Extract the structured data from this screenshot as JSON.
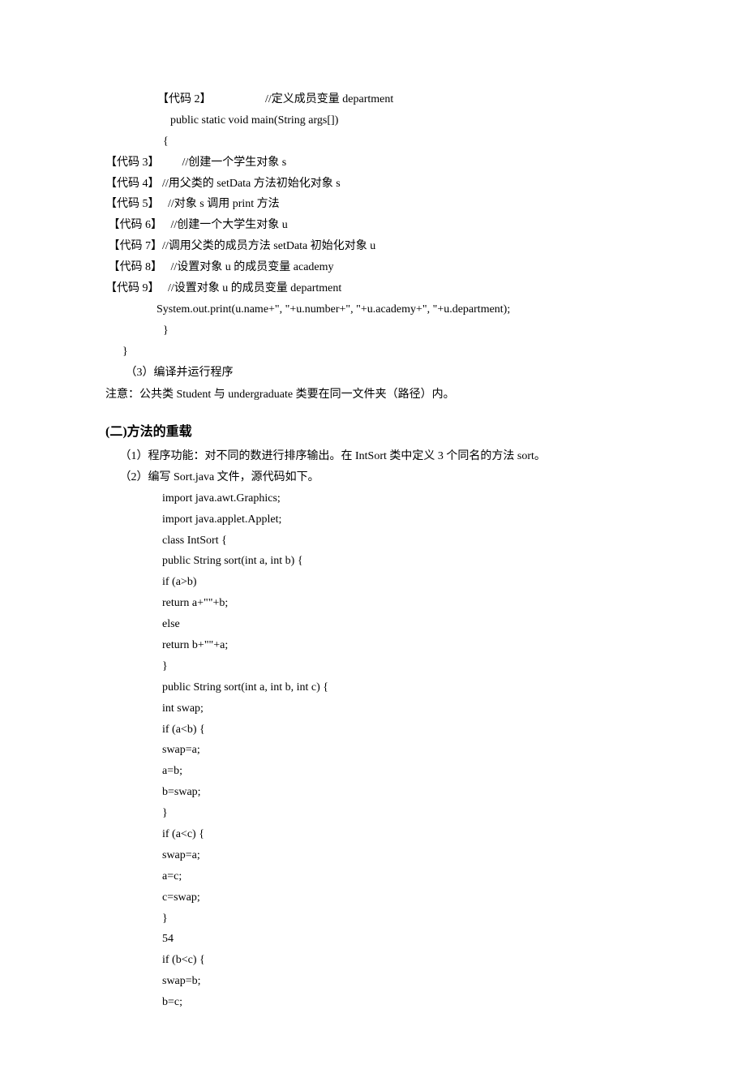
{
  "lines": [
    {
      "cls": "line indent1",
      "text": "【代码 2】                   //定义成员变量 department"
    },
    {
      "cls": "line indent2",
      "text": "public static void main(String args[])"
    },
    {
      "cls": "line indent1",
      "text": "  {"
    },
    {
      "cls": "line",
      "text": "【代码 3】        //创建一个学生对象 s"
    },
    {
      "cls": "line",
      "text": "【代码 4】 //用父类的 setData 方法初始化对象 s"
    },
    {
      "cls": "line",
      "text": "【代码 5】   //对象 s 调用 print 方法"
    },
    {
      "cls": "line",
      "text": " 【代码 6】   //创建一个大学生对象 u"
    },
    {
      "cls": "line",
      "text": " 【代码 7】//调用父类的成员方法 setData 初始化对象 u"
    },
    {
      "cls": "line",
      "text": " 【代码 8】   //设置对象 u 的成员变量 academy"
    },
    {
      "cls": "line",
      "text": "【代码 9】   //设置对象 u 的成员变量 department"
    },
    {
      "cls": "line",
      "text": "                  System.out.print(u.name+\", \"+u.number+\", \"+u.academy+\", \"+u.department);"
    },
    {
      "cls": "line indent1",
      "text": "  }"
    },
    {
      "cls": "line",
      "text": "      }"
    },
    {
      "cls": "line",
      "text": "       （3）编译并运行程序"
    },
    {
      "cls": "line note",
      "text": "注意：公共类 Student 与 undergraduate 类要在同一文件夹（路径）内。"
    },
    {
      "cls": "heading",
      "text": "(二)方法的重载"
    },
    {
      "cls": "line",
      "text": "     （1）程序功能：对不同的数进行排序输出。在 IntSort 类中定义 3 个同名的方法 sort。"
    },
    {
      "cls": "line",
      "text": "     （2）编写 Sort.java 文件，源代码如下。"
    },
    {
      "cls": "line indent3",
      "text": "import java.awt.Graphics;"
    },
    {
      "cls": "line indent3",
      "text": "import java.applet.Applet;"
    },
    {
      "cls": "line indent3",
      "text": "class IntSort {"
    },
    {
      "cls": "line indent3",
      "text": "public String sort(int a, int b) {"
    },
    {
      "cls": "line indent3",
      "text": "if (a>b)"
    },
    {
      "cls": "line indent3",
      "text": "return a+\"\"+b;"
    },
    {
      "cls": "line indent3",
      "text": "else"
    },
    {
      "cls": "line indent3",
      "text": "return b+\"\"+a;"
    },
    {
      "cls": "line indent3",
      "text": "}"
    },
    {
      "cls": "line indent3",
      "text": "public String sort(int a, int b, int c) {"
    },
    {
      "cls": "line indent3",
      "text": "int swap;"
    },
    {
      "cls": "line indent3",
      "text": "if (a<b) {"
    },
    {
      "cls": "line indent3",
      "text": "swap=a;"
    },
    {
      "cls": "line indent3",
      "text": "a=b;"
    },
    {
      "cls": "line indent3",
      "text": "b=swap;"
    },
    {
      "cls": "line indent3",
      "text": "}"
    },
    {
      "cls": "line indent3",
      "text": "if (a<c) {"
    },
    {
      "cls": "line indent3",
      "text": "swap=a;"
    },
    {
      "cls": "line indent3",
      "text": "a=c;"
    },
    {
      "cls": "line indent3",
      "text": "c=swap;"
    },
    {
      "cls": "line indent3",
      "text": "}"
    },
    {
      "cls": "line indent3",
      "text": "54"
    },
    {
      "cls": "line indent3",
      "text": "if (b<c) {"
    },
    {
      "cls": "line indent3",
      "text": "swap=b;"
    },
    {
      "cls": "line indent3",
      "text": "b=c;"
    }
  ]
}
